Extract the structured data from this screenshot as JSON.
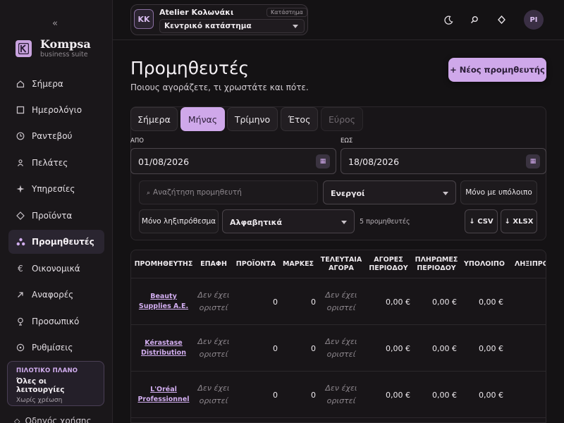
{
  "sidebar": {
    "collapse": "«",
    "brand": {
      "name": "Kompsa",
      "sub": "business suite"
    },
    "items": [
      {
        "label": "Σήμερα",
        "icon": "home-icon"
      },
      {
        "label": "Ημερολόγιο",
        "icon": "calendar-icon"
      },
      {
        "label": "Ραντεβού",
        "icon": "clock-icon"
      },
      {
        "label": "Πελάτες",
        "icon": "user-icon"
      },
      {
        "label": "Υπηρεσίες",
        "icon": "sparkle-icon"
      },
      {
        "label": "Προϊόντα",
        "icon": "diamond-icon"
      },
      {
        "label": "Προμηθευτές",
        "icon": "suppliers-icon",
        "active": true
      },
      {
        "label": "Οικονομικά",
        "icon": "euro-icon"
      },
      {
        "label": "Αναφορές",
        "icon": "arrow-up-right-icon"
      },
      {
        "label": "Προσωπικό",
        "icon": "staff-icon"
      },
      {
        "label": "Ρυθμίσεις",
        "icon": "gear-icon"
      }
    ],
    "plan": {
      "tag": "ΠΙΛΟΤΙΚΟ ΠΛΑΝΟ",
      "title": "Όλες οι λειτουργίες",
      "sub": "Χωρίς χρέωση"
    },
    "guide": "Οδηγός χρήσης"
  },
  "topbar": {
    "store_initials": "KK",
    "store_name": "Atelier Κολωνάκι",
    "store_tag": "Κατάστημα",
    "store_select": "Κεντρικό κατάστημα",
    "user_initials": "PI"
  },
  "page": {
    "title": "Προμηθευτές",
    "subtitle": "Ποιους αγοράζετε, τι χρωστάτε και πότε.",
    "new_button": "+ Νέος προμηθευτής"
  },
  "filters": {
    "tabs": [
      {
        "label": "Σήμερα",
        "state": "normal"
      },
      {
        "label": "Μήνας",
        "state": "active"
      },
      {
        "label": "Τρίμηνο",
        "state": "normal"
      },
      {
        "label": "Έτος",
        "state": "normal"
      },
      {
        "label": "Εύρος",
        "state": "disabled"
      }
    ],
    "from_label": "ΑΠΟ",
    "from_value": "01/08/2026",
    "to_label": "ΕΩΣ",
    "to_value": "18/08/2026",
    "search_placeholder": "Αναζήτηση προμηθευτή",
    "status_select": "Ενεργοί",
    "balance_only": "Μόνο με υπόλοιπο",
    "overdue_only": "Μόνο ληξιπρόθεσμα",
    "sort_select": "Αλφαβητικά",
    "count": "5 προμηθευτές",
    "export_csv": "↓ CSV",
    "export_xlsx": "↓ XLSX"
  },
  "table": {
    "headers": [
      "ΠΡΟΜΗΘΕΥΤΗΣ",
      "ΕΠΑΦΗ",
      "ΠΡΟΪΟΝΤΑ",
      "ΜΑΡΚΕΣ",
      "ΤΕΛΕΥΤΑΙΑ ΑΓΟΡΑ",
      "ΑΓΟΡΕΣ ΠΕΡΙΟΔΟΥ",
      "ΠΛΗΡΩΜΕΣ ΠΕΡΙΟΔΟΥ",
      "ΥΠΟΛΟΙΠΟ",
      "ΛΗΞΙΠΡΟΘΕΣΜΑ"
    ],
    "rows": [
      {
        "supplier": "Beauty Supplies Α.Ε.",
        "contact": "Δεν έχει οριστεί",
        "products": "0",
        "brands": "0",
        "last_purchase": "Δεν έχει οριστεί",
        "purchases": "0,00 €",
        "payments": "0,00 €",
        "balance": "0,00 €"
      },
      {
        "supplier": "Kérastase Distribution",
        "contact": "Δεν έχει οριστεί",
        "products": "0",
        "brands": "0",
        "last_purchase": "Δεν έχει οριστεί",
        "purchases": "0,00 €",
        "payments": "0,00 €",
        "balance": "0,00 €"
      },
      {
        "supplier": "L'Oréal Professionnel",
        "contact": "Δεν έχει οριστεί",
        "products": "0",
        "brands": "0",
        "last_purchase": "Δεν έχει οριστεί",
        "purchases": "0,00 €",
        "payments": "0,00 €",
        "balance": "0,00 €"
      }
    ]
  }
}
